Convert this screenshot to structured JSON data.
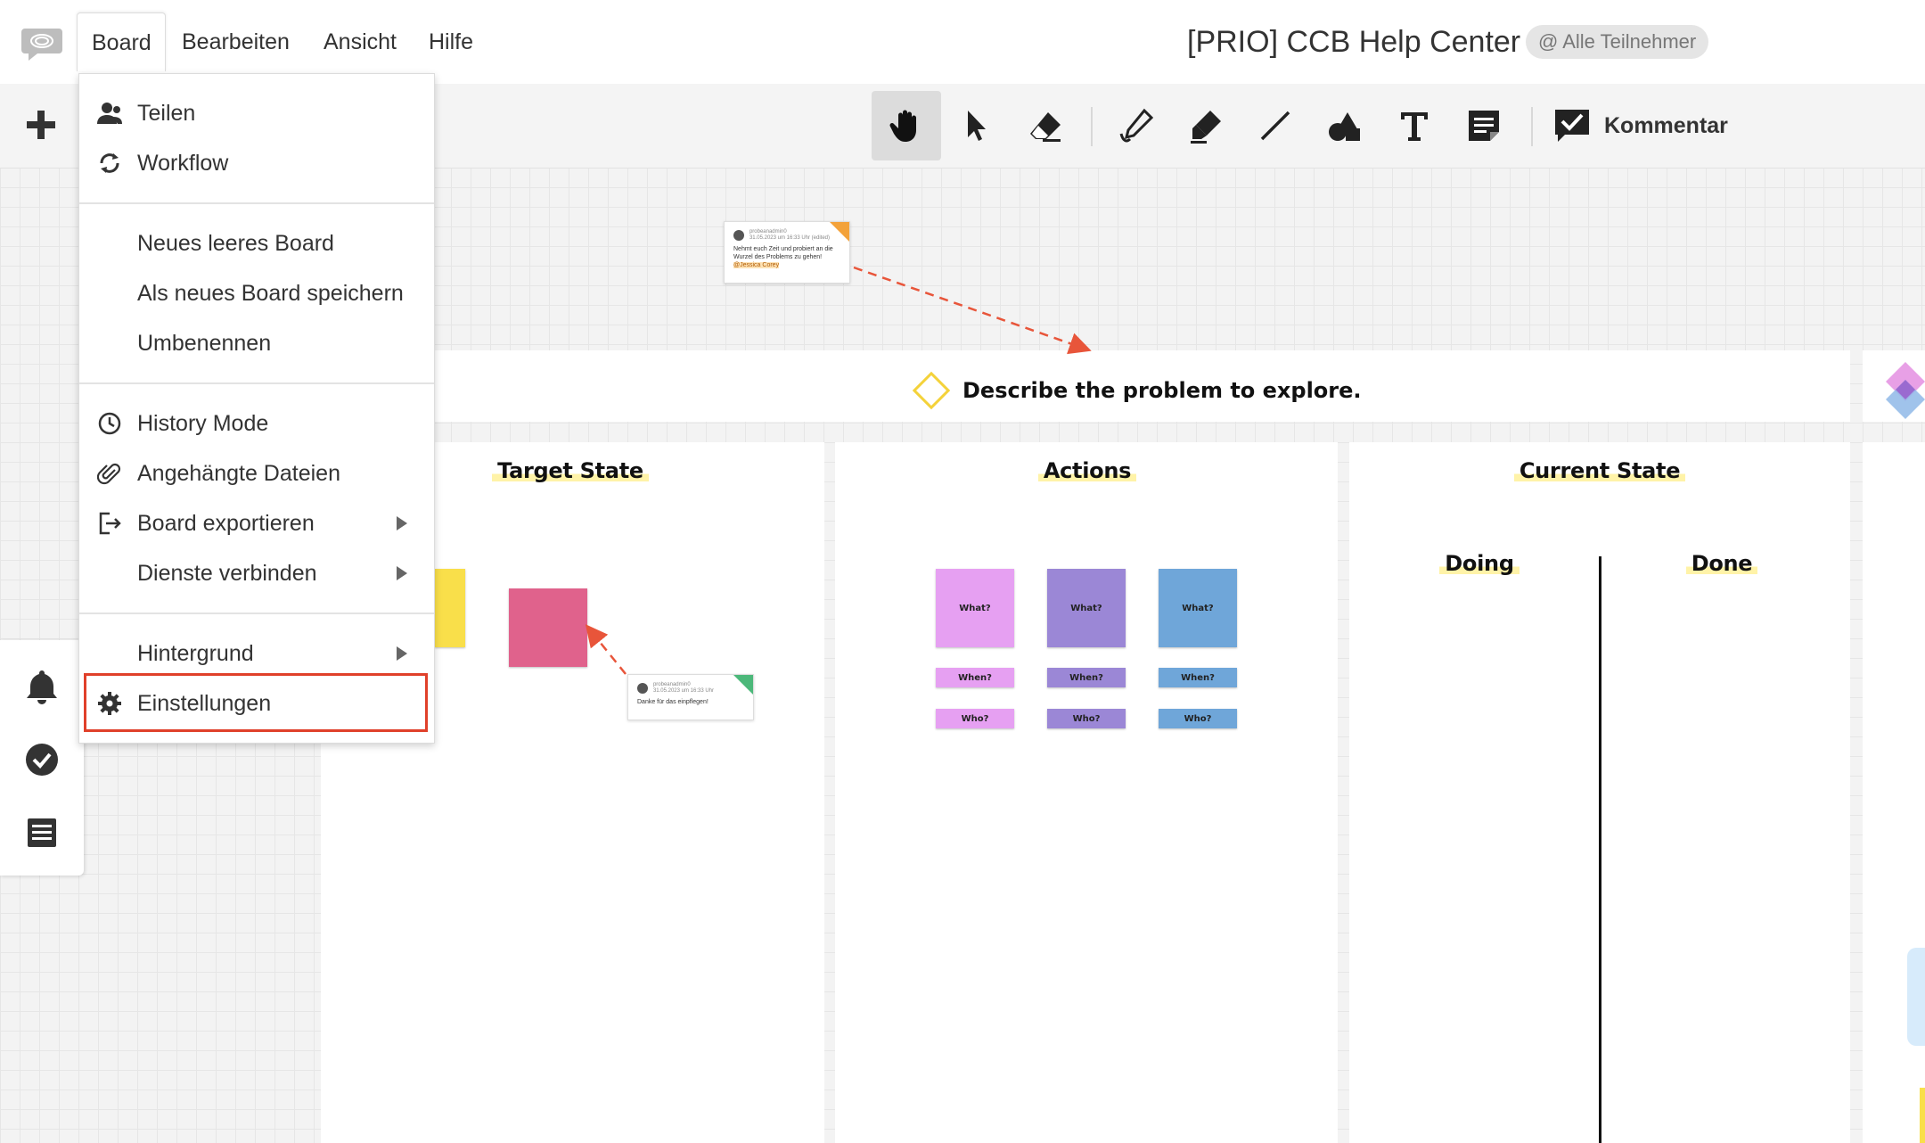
{
  "menubar": {
    "items": [
      {
        "label": "Board"
      },
      {
        "label": "Bearbeiten"
      },
      {
        "label": "Ansicht"
      },
      {
        "label": "Hilfe"
      }
    ],
    "board_title": "[PRIO] CCB Help Center",
    "participants_label": "@ Alle Teilnehmer"
  },
  "toolbar": {
    "tools": [
      "hand-icon",
      "pointer-icon",
      "eraser-icon",
      "pen-icon",
      "highlighter-icon",
      "line-icon",
      "shapes-icon",
      "text-icon",
      "sticky-note-icon"
    ],
    "active_tool": "hand-icon",
    "comment_label": "Kommentar"
  },
  "dropdown": {
    "groups": [
      [
        {
          "label": "Teilen",
          "icon": "share-user-icon"
        },
        {
          "label": "Workflow",
          "icon": "workflow-icon"
        }
      ],
      [
        {
          "label": "Neues leeres Board"
        },
        {
          "label": "Als neues Board speichern"
        },
        {
          "label": "Umbenennen"
        }
      ],
      [
        {
          "label": "History Mode",
          "icon": "clock-icon"
        },
        {
          "label": "Angehängte Dateien",
          "icon": "paperclip-icon"
        },
        {
          "label": "Board exportieren",
          "icon": "export-icon",
          "submenu": true
        },
        {
          "label": "Dienste verbinden",
          "submenu": true
        }
      ],
      [
        {
          "label": "Hintergrund",
          "submenu": true
        },
        {
          "label": "Einstellungen",
          "icon": "gear-icon",
          "highlighted": true
        }
      ]
    ],
    "highlight_color": "#e0402a"
  },
  "canvas": {
    "problem_prompt": "Describe the problem to explore.",
    "sections": [
      {
        "title": "Target State"
      },
      {
        "title": "Actions"
      },
      {
        "title": "Current State"
      }
    ],
    "current_state_columns": [
      "Doing",
      "Done"
    ],
    "actions_notes": [
      {
        "what": "What?",
        "when": "When?",
        "who": "Who?",
        "color": "#e6a0f2"
      },
      {
        "what": "What?",
        "when": "When?",
        "who": "Who?",
        "color": "#9b87d6"
      },
      {
        "what": "What?",
        "when": "When?",
        "who": "Who?",
        "color": "#6fa6d9"
      }
    ],
    "comments": [
      {
        "author": "probeanadmin0",
        "time": "31.05.2023 um 16:33 Uhr (edited)",
        "text": "Nehmt euch Zeit und probiert an die Wurzel des Problems zu gehen!",
        "mention": "@Jessica Corey"
      },
      {
        "author": "probeanadmin0",
        "time": "31.05.2023 um 16:33 Uhr",
        "text": "Danke für das einpflegen!"
      }
    ],
    "colors": {
      "yellow_note": "#f9df4a",
      "pink_note": "#e0628c",
      "arrow": "#e8553a"
    }
  }
}
